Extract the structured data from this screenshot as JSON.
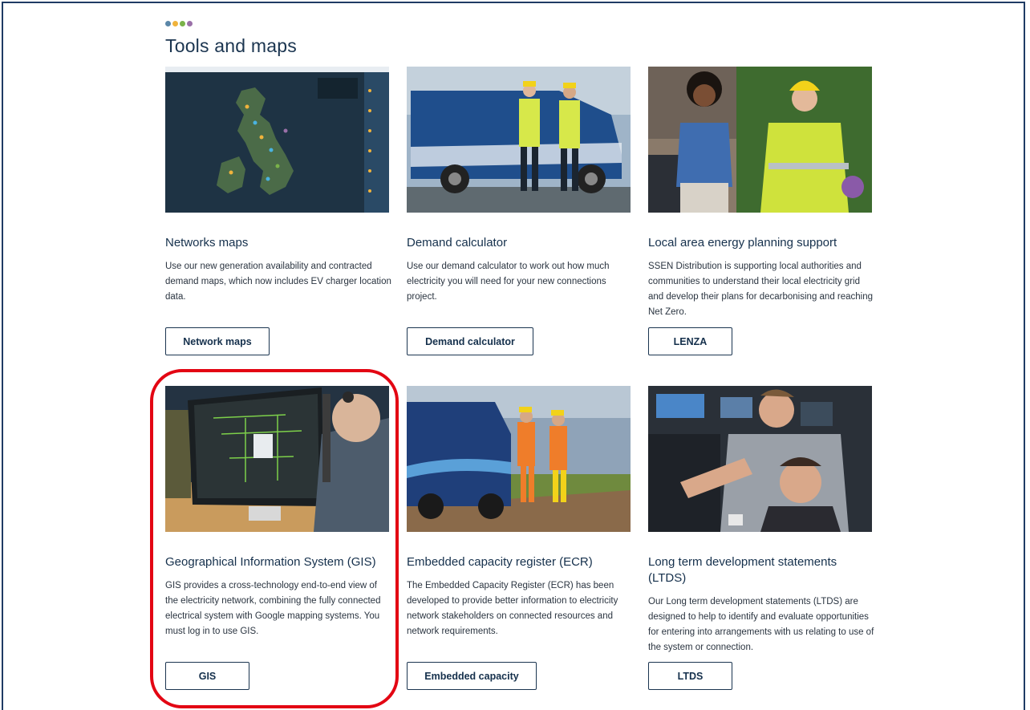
{
  "page": {
    "heading": "Tools and maps",
    "brand_dots": [
      "#5b87a8",
      "#f0b33c",
      "#7ab24a",
      "#9a70a8"
    ]
  },
  "cards": [
    {
      "title": "Networks maps",
      "description": "Use our new generation availability and contracted demand maps, which now includes EV charger location data.",
      "button": "Network maps",
      "image": "uk-network-map-screenshot"
    },
    {
      "title": "Demand calculator",
      "description": "Use our demand calculator to work out how much electricity you will need for your new connections project.",
      "button": "Demand calculator",
      "image": "engineers-with-van-photo"
    },
    {
      "title": "Local area energy planning support",
      "description": "SSEN Distribution is supporting local authorities and communities to understand their local electricity grid and develop their plans for decarbonising and reaching Net Zero.",
      "button": "LENZA",
      "image": "two-women-talking-photo"
    },
    {
      "title": "Geographical Information System (GIS)",
      "description": "GIS provides a cross-technology end-to-end view of the electricity network, combining the fully connected electrical system with Google mapping systems. You must log in to use GIS.",
      "button": "GIS",
      "image": "operator-at-monitors-photo"
    },
    {
      "title": "Embedded capacity register (ECR)",
      "description": "The Embedded Capacity Register (ECR) has been developed to provide better information to electricity network stakeholders on connected resources and network requirements.",
      "button": "Embedded capacity",
      "image": "engineers-walking-field-photo"
    },
    {
      "title": "Long term development statements (LTDS)",
      "description": "Our Long term development statements (LTDS) are designed to help to identify and evaluate opportunities for entering into arrangements with us relating to use of the system or connection.",
      "button": "LTDS",
      "image": "control-room-men-photo"
    }
  ],
  "annotation": {
    "color": "#e30613"
  }
}
